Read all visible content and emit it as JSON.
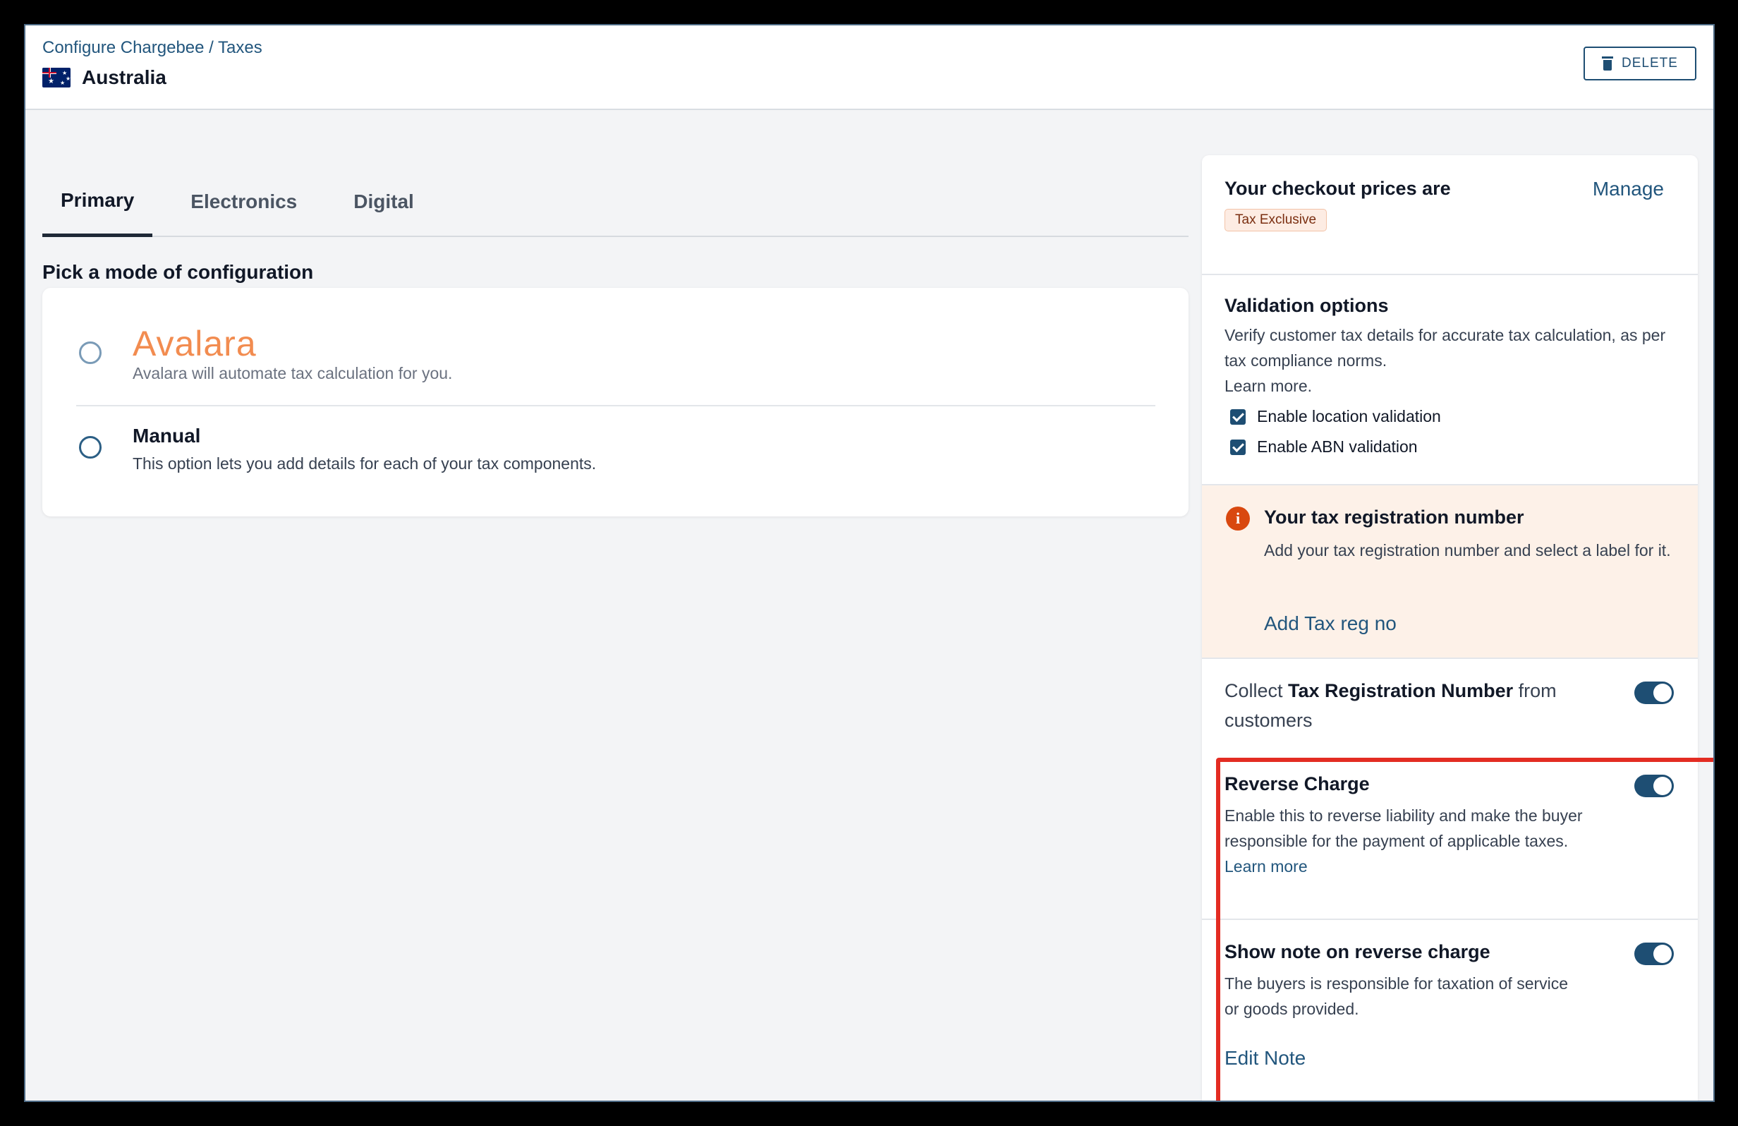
{
  "header": {
    "breadcrumb": "Configure Chargebee / Taxes",
    "country": "Australia",
    "delete_label": "DELETE"
  },
  "tabs": [
    {
      "label": "Primary",
      "active": true
    },
    {
      "label": "Electronics",
      "active": false
    },
    {
      "label": "Digital",
      "active": false
    }
  ],
  "config": {
    "heading": "Pick a mode of configuration",
    "avalara": {
      "logo": "Avalara",
      "description": "Avalara will automate tax calculation for you."
    },
    "manual": {
      "title": "Manual",
      "description": "This option lets you add details for each of your tax components."
    }
  },
  "panel": {
    "checkout": {
      "title": "Your checkout prices are",
      "manage": "Manage",
      "badge": "Tax Exclusive"
    },
    "validation": {
      "title": "Validation options",
      "description": "Verify customer tax details for accurate tax calculation, as per tax compliance norms.",
      "learn_more": "Learn more.",
      "options": [
        {
          "label": "Enable location validation",
          "checked": true
        },
        {
          "label": "Enable ABN validation",
          "checked": true
        }
      ]
    },
    "registration": {
      "title": "Your tax registration number",
      "description": "Add your tax registration number and select a label for it.",
      "action": "Add Tax reg no"
    },
    "collect": {
      "prefix": "Collect ",
      "bold": "Tax Registration Number",
      "suffix": " from customers",
      "enabled": true
    },
    "reverse_charge": {
      "title": "Reverse Charge",
      "description": "Enable this to reverse liability and make the buyer responsible for the payment of applicable taxes.",
      "learn_more": "Learn more",
      "enabled": true
    },
    "note": {
      "title": "Show note on reverse charge",
      "description": "The buyers is responsible for taxation of service or goods provided.",
      "action": "Edit Note",
      "enabled": true
    }
  },
  "colors": {
    "accent": "#1e4e73",
    "avalara": "#f28c50",
    "highlight": "#e32c22",
    "warning_bg": "#fdf1e8"
  }
}
